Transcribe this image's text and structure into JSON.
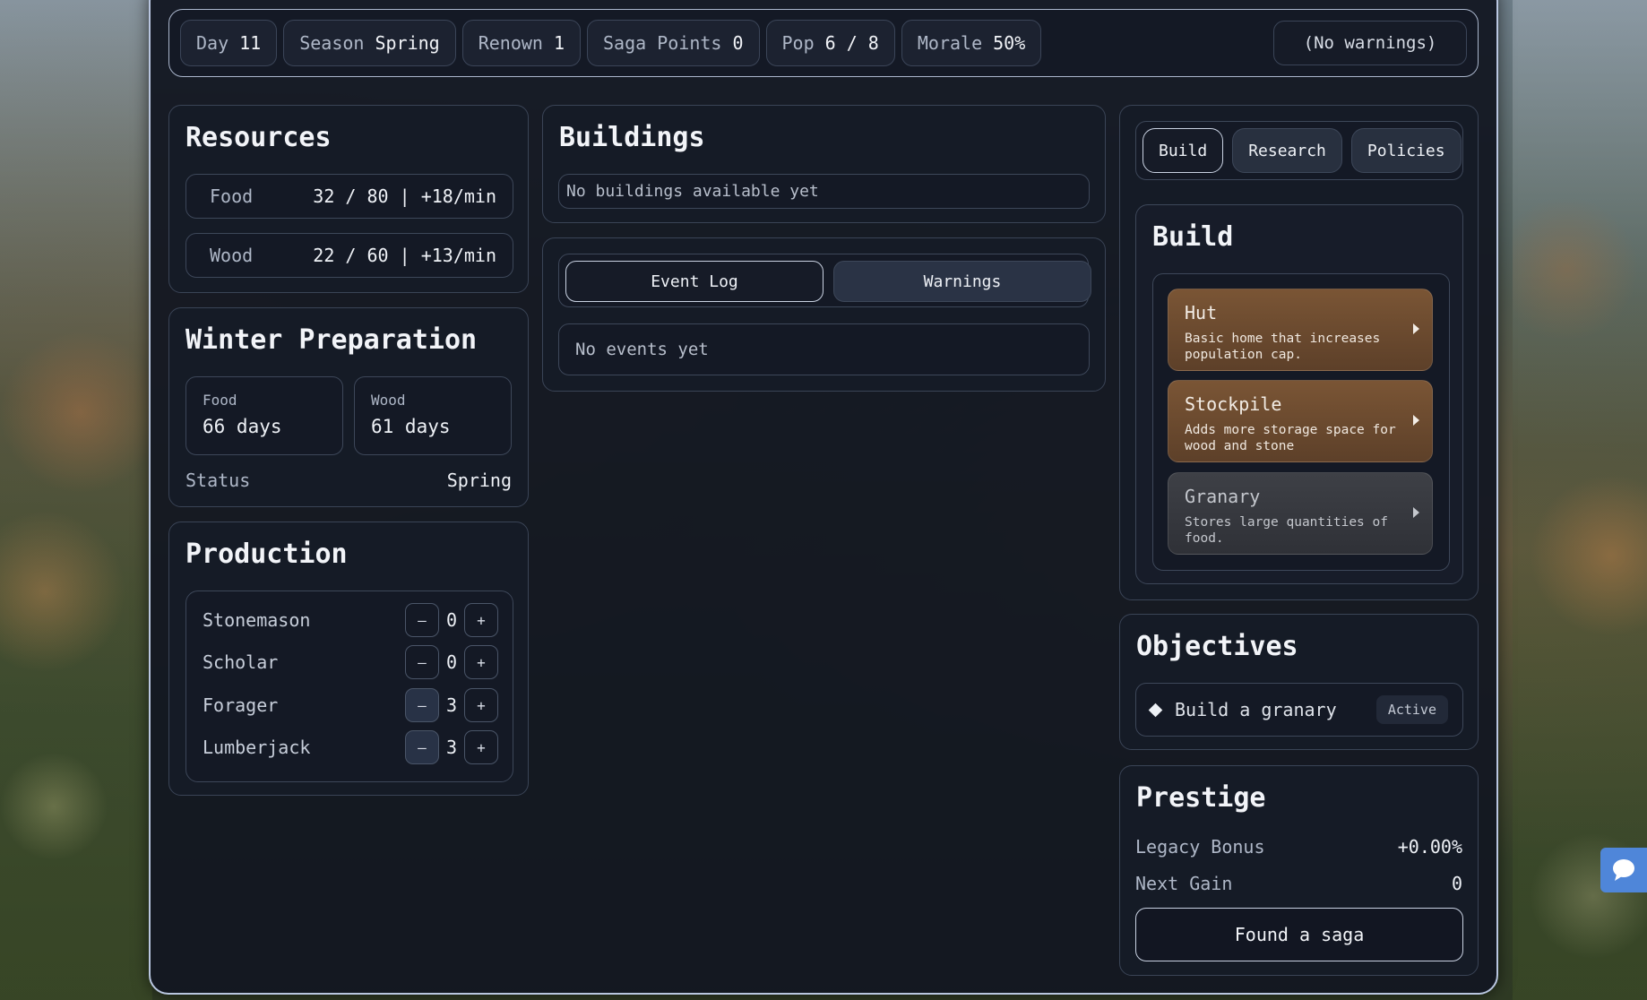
{
  "topbar": {
    "stats": [
      {
        "label": "Day",
        "value": "11"
      },
      {
        "label": "Season",
        "value": "Spring"
      },
      {
        "label": "Renown",
        "value": "1"
      },
      {
        "label": "Saga Points",
        "value": "0"
      },
      {
        "label": "Pop",
        "value": "6 / 8"
      },
      {
        "label": "Morale",
        "value": "50%"
      }
    ],
    "warnings": "(No warnings)"
  },
  "resources": {
    "title": "Resources",
    "rows": [
      {
        "label": "Food",
        "value": "32 / 80 | +18/min"
      },
      {
        "label": "Wood",
        "value": "22 / 60 | +13/min"
      }
    ]
  },
  "winter": {
    "title": "Winter Preparation",
    "cards": [
      {
        "label": "Food",
        "value": "66 days"
      },
      {
        "label": "Wood",
        "value": "61 days"
      }
    ],
    "status_label": "Status",
    "status_value": "Spring"
  },
  "production": {
    "title": "Production",
    "rows": [
      {
        "label": "Stonemason",
        "value": "0",
        "minus": "–",
        "plus": "+"
      },
      {
        "label": "Scholar",
        "value": "0",
        "minus": "–",
        "plus": "+"
      },
      {
        "label": "Forager",
        "value": "3",
        "minus": "–",
        "plus": "+"
      },
      {
        "label": "Lumberjack",
        "value": "3",
        "minus": "–",
        "plus": "+"
      }
    ]
  },
  "buildings": {
    "title": "Buildings",
    "empty": "No buildings available yet"
  },
  "log": {
    "tabs": [
      "Event Log",
      "Warnings"
    ],
    "empty": "No events yet"
  },
  "right_tabs": [
    "Build",
    "Research",
    "Policies"
  ],
  "build": {
    "title": "Build",
    "items": [
      {
        "name": "Hut",
        "desc": "Basic home that increases population cap.",
        "style": "brown"
      },
      {
        "name": "Stockpile",
        "desc": "Adds more storage space for wood and stone",
        "style": "brown"
      },
      {
        "name": "Granary",
        "desc": "Stores large quantities of food.",
        "style": "gray"
      }
    ]
  },
  "objectives": {
    "title": "Objectives",
    "items": [
      {
        "label": "Build a granary",
        "status": "Active"
      }
    ]
  },
  "prestige": {
    "title": "Prestige",
    "legacy_label": "Legacy Bonus",
    "legacy_value": "+0.00%",
    "next_label": "Next Gain",
    "next_value": "0",
    "button": "Found a saga"
  },
  "colors": {
    "panel_bg": "#161b27",
    "accent_border": "#c9d2e2",
    "build_card_brown": "#7a5535",
    "build_card_gray": "#3e4046",
    "chat_button": "#4f86d9"
  },
  "icons": {
    "chat": "chat-bubble-icon",
    "objective_bullet": "diamond-icon",
    "build_arrow": "chevron-right-icon"
  }
}
